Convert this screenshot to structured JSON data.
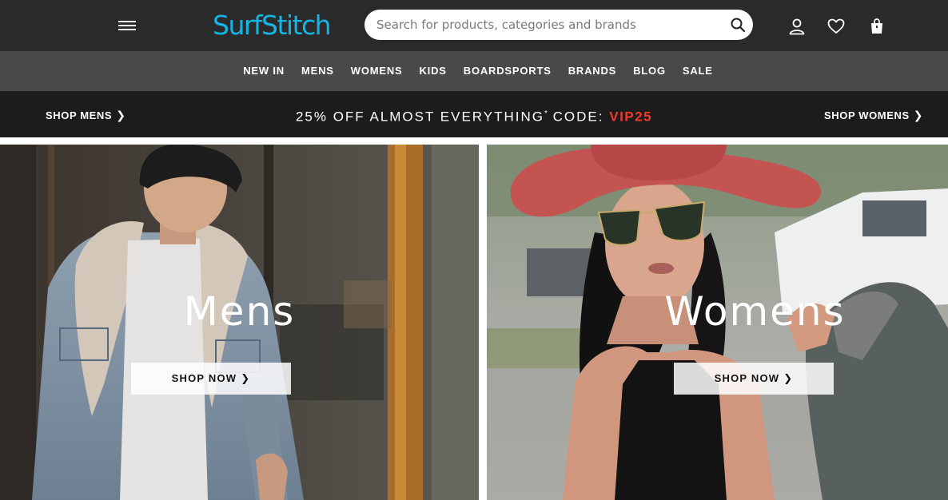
{
  "header": {
    "logo": "SurfStitch",
    "search": {
      "placeholder": "Search for products, categories and brands",
      "value": ""
    }
  },
  "nav": [
    "NEW IN",
    "MENS",
    "WOMENS",
    "KIDS",
    "BOARDSPORTS",
    "BRANDS",
    "BLOG",
    "SALE"
  ],
  "promo": {
    "shop_mens": "SHOP MENS",
    "shop_womens": "SHOP WOMENS",
    "text": "25% OFF ALMOST EVERYTHING",
    "asterisk": "*",
    "code_label": "CODE:",
    "code": "VIP25"
  },
  "hero": {
    "mens": {
      "title": "Mens",
      "button": "SHOP NOW"
    },
    "womens": {
      "title": "Womens",
      "button": "SHOP NOW"
    }
  },
  "colors": {
    "brand": "#14b5e5",
    "header_bg": "#2b2a2a",
    "nav_bg": "#4a4949",
    "promo_bg": "#1d1c1c",
    "promo_code": "#ef3b2c"
  },
  "icons": [
    "hamburger-menu-icon",
    "search-icon",
    "user-icon",
    "heart-icon",
    "shopping-bag-icon",
    "chevron-right-icon"
  ]
}
